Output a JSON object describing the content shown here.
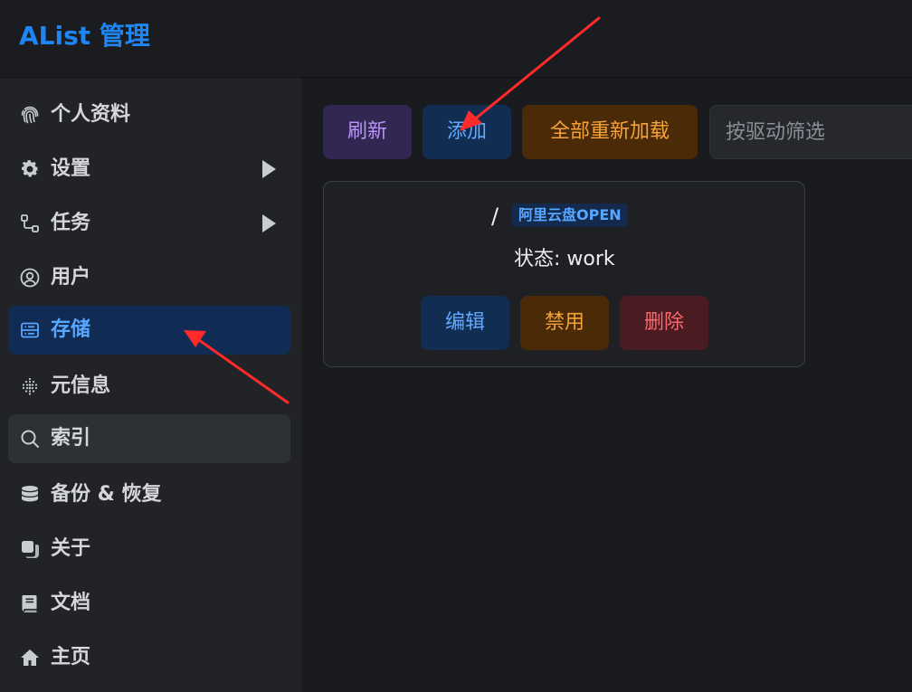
{
  "app": {
    "title": "AList 管理"
  },
  "sidebar": {
    "items": [
      {
        "label": "个人资料",
        "icon": "fingerprint-icon"
      },
      {
        "label": "设置",
        "icon": "gear-icon"
      },
      {
        "label": "任务",
        "icon": "workflow-icon"
      },
      {
        "label": "用户",
        "icon": "user-circle-icon"
      },
      {
        "label": "存储",
        "icon": "storage-icon"
      },
      {
        "label": "元信息",
        "icon": "dots-grid-icon"
      },
      {
        "label": "索引",
        "icon": "search-icon"
      },
      {
        "label": "备份 & 恢复",
        "icon": "database-icon"
      },
      {
        "label": "关于",
        "icon": "copy-icon"
      },
      {
        "label": "文档",
        "icon": "book-icon"
      },
      {
        "label": "主页",
        "icon": "home-icon"
      }
    ],
    "active": "存储"
  },
  "toolbar": {
    "refresh_label": "刷新",
    "add_label": "添加",
    "reload_all_label": "全部重新加载",
    "filter_placeholder": "按驱动筛选"
  },
  "storage_card": {
    "mount_path": "/",
    "driver": "阿里云盘OPEN",
    "status": "状态: work",
    "edit_label": "编辑",
    "disable_label": "禁用",
    "delete_label": "删除"
  },
  "colors": {
    "accent": "#1e86f4",
    "annotation_arrow": "#ff2a2a"
  }
}
